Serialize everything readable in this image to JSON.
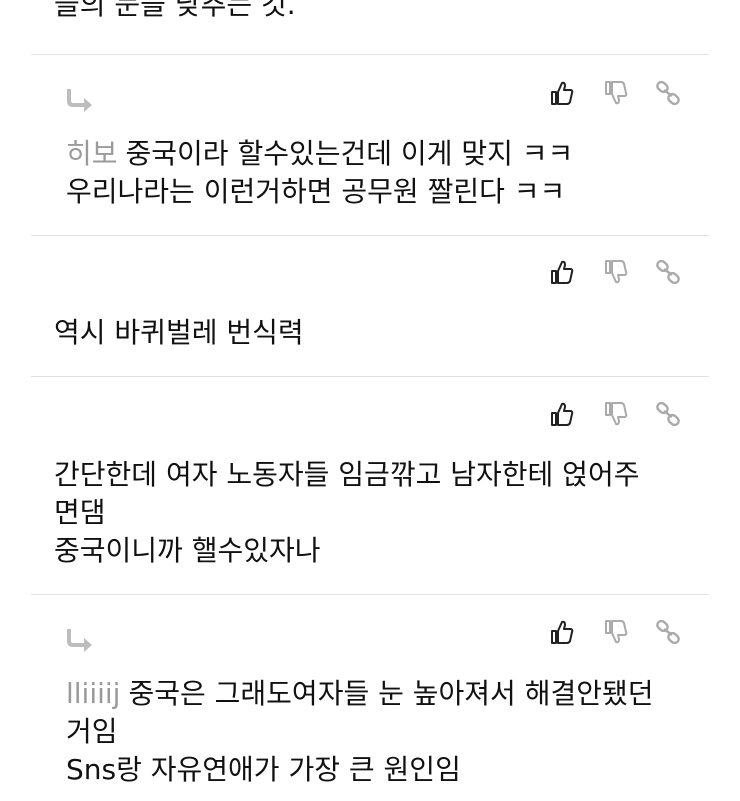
{
  "top": {
    "text": "들의 눈을 낮추는 것."
  },
  "comments": [
    {
      "is_reply": true,
      "author": "히보",
      "lines": [
        "중국이라 할수있는건데 이게 맞지 ㅋㅋ",
        "우리나라는 이런거하면 공무원 짤린다 ㅋㅋ"
      ]
    },
    {
      "is_reply": false,
      "author": "",
      "lines": [
        "역시 바퀴벌레 번식력"
      ]
    },
    {
      "is_reply": false,
      "author": "",
      "lines": [
        "간단한데 여자 노동자들 임금깎고 남자한테 얹어주",
        "면댐",
        "중국이니까 핼수있자나"
      ]
    },
    {
      "is_reply": true,
      "author": "lliiiij",
      "lines": [
        "중국은 그래도여자들 눈 높아져서 해결안됐던",
        "거임",
        "Sns랑 자유연애가 가장 큰 원인임"
      ]
    }
  ],
  "icons": {
    "like": "thumbs-up-icon",
    "dislike": "thumbs-down-icon",
    "link": "link-icon",
    "reply": "reply-arrow-icon"
  },
  "colors": {
    "divider": "#e2e2e2",
    "author": "#9a9a9a",
    "active_icon": "#222222",
    "muted_icon": "#aaaaaa"
  }
}
